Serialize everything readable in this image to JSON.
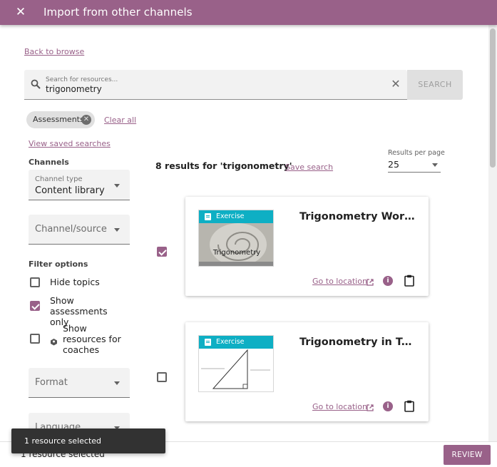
{
  "header": {
    "title": "Import from other channels",
    "close_icon": "close-icon"
  },
  "back_link": "Back to browse",
  "search": {
    "placeholder": "Search for resources...",
    "value": "trigonometry",
    "button_label": "SEARCH"
  },
  "chips": [
    {
      "label": "Assessments"
    }
  ],
  "clear_all": "Clear all",
  "view_saved": "View saved searches",
  "sidebar": {
    "channels_heading": "Channels",
    "channel_type": {
      "label": "Channel type",
      "value": "Content library"
    },
    "channel_source": {
      "placeholder": "Channel/source"
    },
    "filter_heading": "Filter options",
    "options": [
      {
        "label": "Hide topics",
        "checked": false
      },
      {
        "label": "Show assessments only",
        "checked": true
      },
      {
        "label": "Show resources for coaches",
        "checked": false,
        "icon": "coach-icon"
      }
    ],
    "format": {
      "placeholder": "Format"
    },
    "language": {
      "placeholder": "Language"
    }
  },
  "results": {
    "summary": "8 results for 'trigonometry'",
    "save_search": "Save search",
    "per_page_label": "Results per page",
    "per_page_value": "25"
  },
  "cards": [
    {
      "title": "Trigonometry Wor…",
      "kind": "Exercise",
      "goto": "Go to location",
      "selected": true,
      "thumb_text": "Trigonometry"
    },
    {
      "title": "Trigonometry in Te…",
      "kind": "Exercise",
      "goto": "Go to location",
      "selected": false
    }
  ],
  "footer": {
    "count": "1 resource selected",
    "review_label": "REVIEW"
  },
  "snackbar": {
    "message": "1 resource selected"
  },
  "colors": {
    "brand": "#996189",
    "exercise_badge": "#0eafc4"
  }
}
